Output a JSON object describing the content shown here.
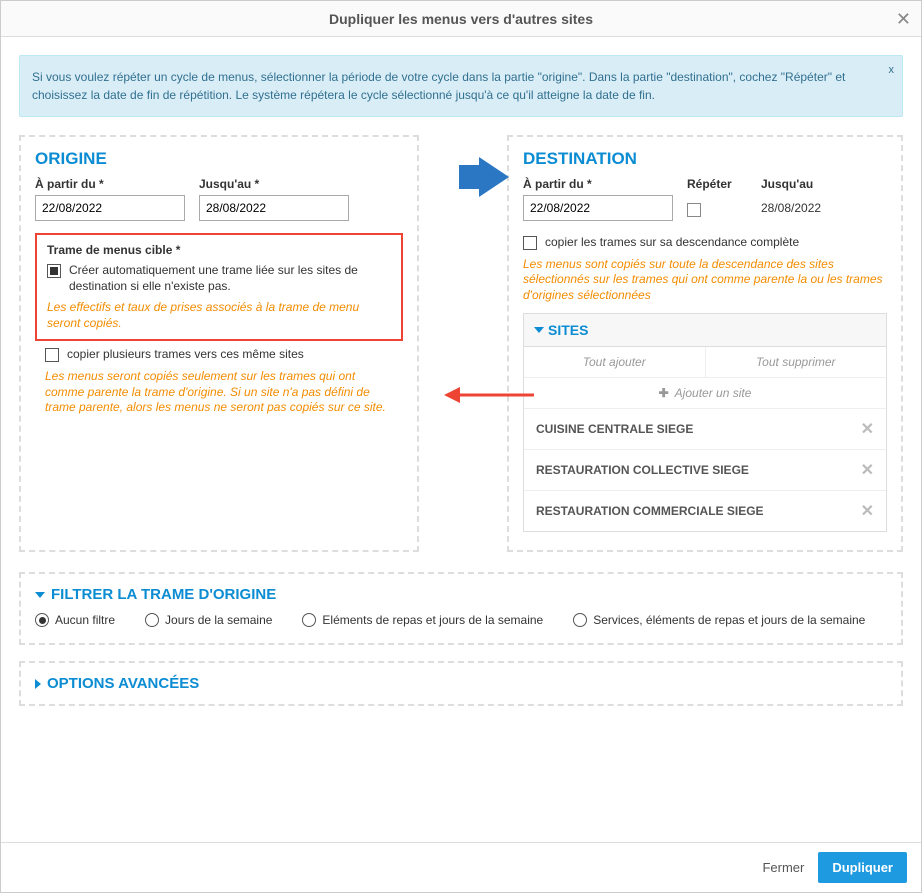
{
  "header": {
    "title": "Dupliquer les menus vers d'autres sites"
  },
  "info": {
    "text": "Si vous voulez répéter un cycle de menus, sélectionner la période de votre cycle dans la partie \"origine\". Dans la partie \"destination\", cochez \"Répéter\" et choisissez la date de fin de répétition. Le système répétera le cycle sélectionné jusqu'à ce qu'il atteigne la date de fin.",
    "close": "x"
  },
  "origin": {
    "title": "ORIGINE",
    "from_label": "À partir du *",
    "from_value": "22/08/2022",
    "to_label": "Jusqu'au *",
    "to_value": "28/08/2022",
    "trame_label": "Trame de menus cible *",
    "auto_create_text": "Créer automatiquement une trame liée sur les sites de destination si elle n'existe pas.",
    "effectifs_note": "Les effectifs et taux de prises associés à la trame de menu seront copiés.",
    "multi_trames_text": "copier plusieurs trames vers ces même sites",
    "multi_trames_note": "Les menus seront copiés seulement sur les trames qui ont comme parente la trame d'origine. Si un site n'a pas défini de trame parente, alors les menus ne seront pas copiés sur ce site."
  },
  "destination": {
    "title": "DESTINATION",
    "from_label": "À partir du *",
    "from_value": "22/08/2022",
    "repeat_label": "Répéter",
    "to_label": "Jusqu'au",
    "to_value": "28/08/2022",
    "descend_text": "copier les trames sur sa descendance complète",
    "descend_note": "Les menus sont copiés sur toute la descendance des sites sélectionnés sur les trames qui ont comme parente la ou les trames d'origines sélectionnées",
    "sites": {
      "header": "SITES",
      "add_all": "Tout ajouter",
      "remove_all": "Tout supprimer",
      "add_site": "Ajouter un site",
      "items": [
        "CUISINE CENTRALE SIEGE",
        "RESTAURATION COLLECTIVE SIEGE",
        "RESTAURATION COMMERCIALE SIEGE"
      ]
    }
  },
  "filter": {
    "title": "FILTRER LA TRAME D'ORIGINE",
    "options": [
      "Aucun filtre",
      "Jours de la semaine",
      "Eléments de repas et jours de la semaine",
      "Services, éléments de repas et jours de la semaine"
    ]
  },
  "advanced": {
    "title": "OPTIONS AVANCÉES"
  },
  "footer": {
    "close": "Fermer",
    "duplicate": "Dupliquer"
  }
}
